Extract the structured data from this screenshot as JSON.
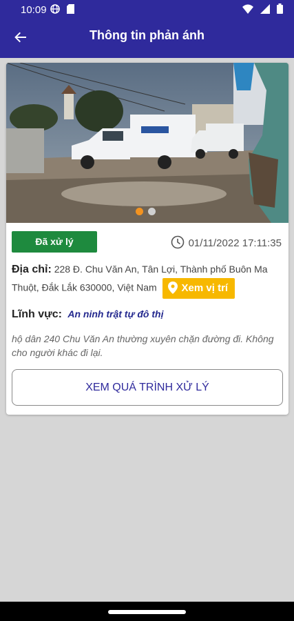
{
  "status_bar": {
    "time": "10:09"
  },
  "app_bar": {
    "title": "Thông tin phản ánh"
  },
  "report": {
    "status": "Đã xử lý",
    "timestamp": "01/11/2022 17:11:35",
    "address_label": "Địa chỉ:",
    "address": "228 Đ. Chu Văn An, Tân Lợi, Thành phố Buôn Ma Thuột, Đắk Lắk 630000, Việt Nam",
    "locate_button": "Xem vị trí",
    "field_label": "Lĩnh vực:",
    "field_value": "An ninh trật tự đô thị",
    "description": "hộ dân 240 Chu Văn An thường xuyên chặn đường đi. Không cho người khác đi lại.",
    "process_button": "XEM QUÁ TRÌNH XỬ LÝ",
    "image_count": 2,
    "image_index": 1
  },
  "colors": {
    "primary": "#2f2a9c",
    "status_done": "#1e8a3e",
    "locate": "#f7b800",
    "dot_active": "#f39320",
    "field_value": "#23288e"
  }
}
